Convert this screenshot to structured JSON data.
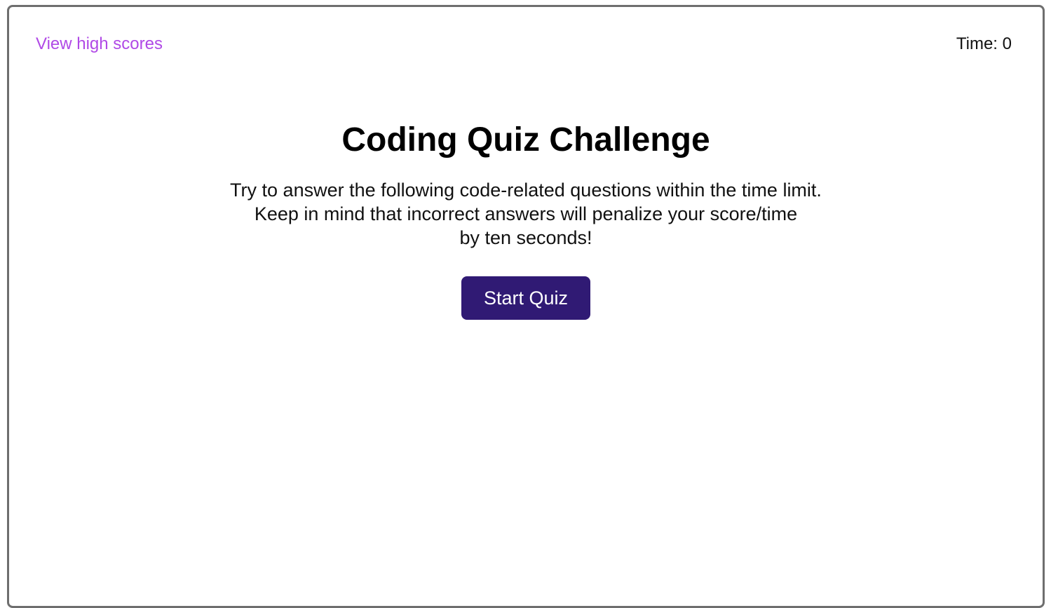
{
  "header": {
    "highscores_link": "View high scores",
    "timer_label": "Time:",
    "timer_value": "0"
  },
  "main": {
    "title": "Coding Quiz Challenge",
    "description_lines": [
      "Try to answer the following code-related questions within the time limit.",
      "Keep in mind that incorrect answers will penalize your score/time",
      "by ten seconds!"
    ],
    "start_button": "Start Quiz"
  },
  "colors": {
    "link": "#b049e6",
    "button_bg": "#301a74",
    "button_text": "#ffffff",
    "frame_border": "#6e6e6e"
  }
}
